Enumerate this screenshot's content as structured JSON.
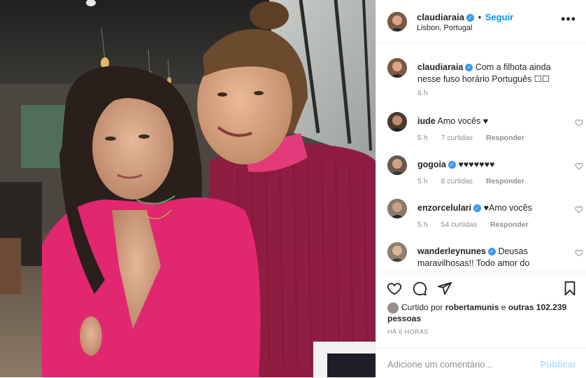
{
  "header": {
    "username": "claudiaraia",
    "separator": "•",
    "follow_label": "Seguir",
    "location": "Lisbon, Portugal",
    "more_label": "•••"
  },
  "caption": {
    "username": "claudiaraia",
    "text": "Com a filhota ainda nesse fuso horário Português ☐☐",
    "time": "6 h"
  },
  "comments": [
    {
      "username": "iude",
      "verified": false,
      "text": "Amo vocês ♥",
      "time": "5 h",
      "likes": "7 curtidas",
      "reply": "Responder"
    },
    {
      "username": "gogoia",
      "verified": true,
      "text": "♥♥♥♥♥♥♥",
      "time": "5 h",
      "likes": "8 curtidas",
      "reply": "Responder"
    },
    {
      "username": "enzorcelulari",
      "verified": true,
      "text": "♥Amo vocês",
      "time": "5 h",
      "likes": "54 curtidas",
      "reply": "Responder"
    },
    {
      "username": "wanderleynunes",
      "verified": true,
      "text": "Deusas maravilhosas!! Todo amor do",
      "time": "",
      "likes": "",
      "reply": ""
    }
  ],
  "likes": {
    "prefix": "Curtido por",
    "user": "robertamunis",
    "middle": "e",
    "others": "outras 102.239 pessoas"
  },
  "timestamp": "HÁ 6 HORAS",
  "add_comment": {
    "placeholder": "Adicione um comentário...",
    "publish_label": "Publicar"
  },
  "colors": {
    "accent": "#0095f6",
    "verified": "#3897f0",
    "meta_text": "#8e8e8e",
    "border": "#efefef",
    "publish_disabled": "#b2dffc"
  }
}
